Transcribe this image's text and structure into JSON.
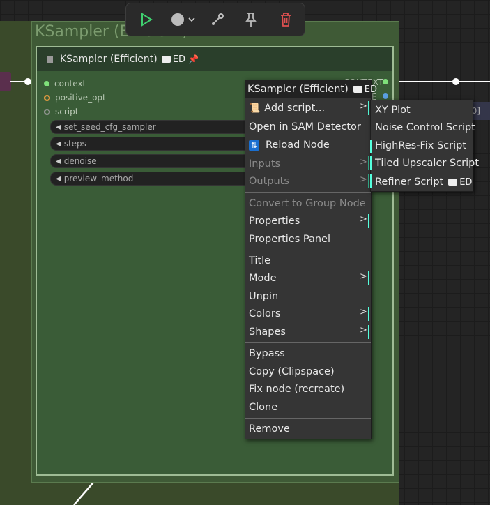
{
  "group": {
    "title": "KSampler (Efficient)"
  },
  "node": {
    "title": "KSampler (Efficient)",
    "badge": "ED",
    "inputs": [
      {
        "label": "context",
        "color": "#7fe07a"
      },
      {
        "label": "positive_opt",
        "color": "#f0a040"
      },
      {
        "label": "script",
        "color": "#9a9a9a"
      }
    ],
    "widgets": [
      "set_seed_cfg_sampler",
      "steps",
      "denoise",
      "preview_method"
    ],
    "output_partial_1": "CONTEXT",
    "output_partial_2": "E"
  },
  "side_panel_partial": "0]",
  "toolbar": {
    "buttons": [
      "run-icon",
      "color-dot-icon",
      "chevron-down-icon",
      "eyedropper-icon",
      "pin-icon",
      "trash-icon"
    ]
  },
  "context_menu": {
    "title": "KSampler (Efficient)",
    "title_badge": "ED",
    "items": {
      "add_script": "Add script...",
      "open_sam": "Open in SAM Detector",
      "reload_node": "Reload Node",
      "inputs": "Inputs",
      "outputs": "Outputs",
      "convert_group": "Convert to Group Node",
      "properties": "Properties",
      "properties_panel": "Properties Panel",
      "title": "Title",
      "mode": "Mode",
      "unpin": "Unpin",
      "colors": "Colors",
      "shapes": "Shapes",
      "bypass": "Bypass",
      "copy_clipspace": "Copy (Clipspace)",
      "fix_node": "Fix node (recreate)",
      "clone": "Clone",
      "remove": "Remove"
    },
    "submenu_arrow": ">"
  },
  "script_submenu": {
    "items": [
      "XY Plot",
      "Noise Control Script",
      "HighRes-Fix Script",
      "Tiled Upscaler Script"
    ],
    "refiner_label": "Refiner Script",
    "refiner_badge": "ED"
  },
  "colors": {
    "accent": "#55ddee",
    "node_bg": "#3a5c37",
    "menu_bg": "#353535",
    "run_icon": "#3fcf6f",
    "trash_icon": "#e05050"
  }
}
